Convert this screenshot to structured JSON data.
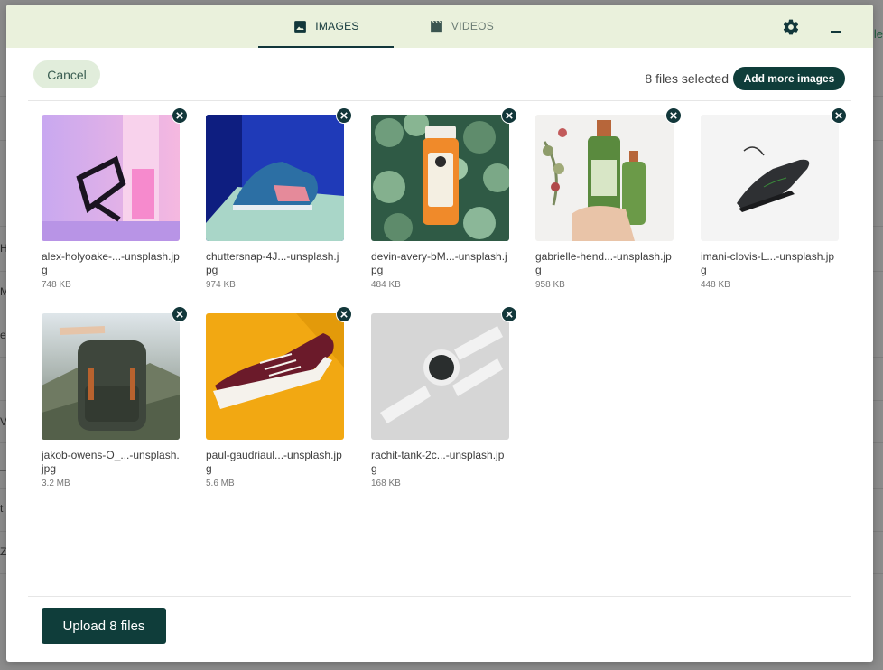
{
  "backdrop": {
    "edge_letters": [
      "H",
      "M",
      "e",
      "V",
      "_",
      "t",
      "Z"
    ],
    "right_edge_letter": "le"
  },
  "tabs": [
    {
      "label": "IMAGES",
      "icon": "image-icon",
      "active": true
    },
    {
      "label": "VIDEOS",
      "icon": "film-icon",
      "active": false
    }
  ],
  "toolbar": {
    "cancel_label": "Cancel",
    "selected_text": "8 files selected",
    "add_more_label": "Add more images",
    "upload_label": "Upload 8 files"
  },
  "colors": {
    "primary": "#0f3d3a",
    "topbar": "#eaf1dc",
    "cancel_bg": "#e1eddb"
  },
  "files": [
    {
      "name": "alex-holyoake-...-unsplash.jpg",
      "size": "748 KB"
    },
    {
      "name": "chuttersnap-4J...-unsplash.jpg",
      "size": "974 KB"
    },
    {
      "name": "devin-avery-bM...-unsplash.jpg",
      "size": "484 KB"
    },
    {
      "name": "gabrielle-hend...-unsplash.jpg",
      "size": "958 KB"
    },
    {
      "name": "imani-clovis-L...-unsplash.jpg",
      "size": "448 KB"
    },
    {
      "name": "jakob-owens-O_...-unsplash.jpg",
      "size": "3.2 MB"
    },
    {
      "name": "paul-gaudriaul...-unsplash.jpg",
      "size": "5.6 MB"
    },
    {
      "name": "rachit-tank-2c...-unsplash.jpg",
      "size": "168 KB"
    }
  ]
}
